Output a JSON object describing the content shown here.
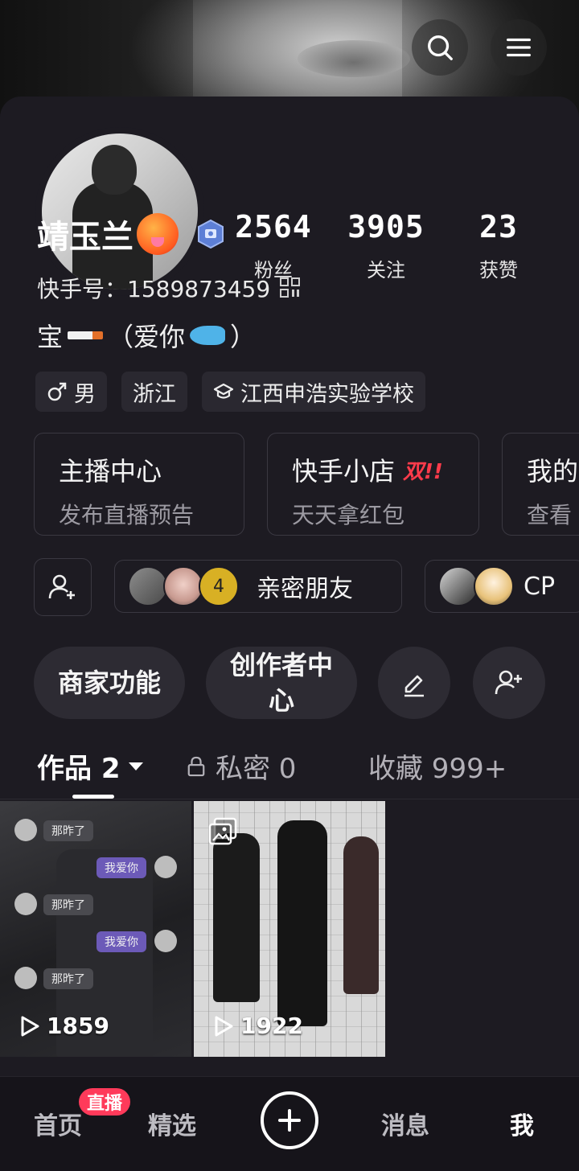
{
  "header": {
    "search_icon": "search-icon",
    "menu_icon": "hamburger-menu-icon"
  },
  "profile": {
    "stats": [
      {
        "value": "2564",
        "label": "粉丝"
      },
      {
        "value": "3905",
        "label": "关注"
      },
      {
        "value": "23",
        "label": "获赞"
      }
    ],
    "nickname": "靖玉兰",
    "account_id": "快手号：1589873459",
    "bio_prefix": "宝",
    "bio_suffix": "（爱你",
    "bio_end": "）",
    "tags": [
      {
        "label": "男",
        "icon": "male-icon"
      },
      {
        "label": "浙江"
      },
      {
        "label": "江西申浩实验学校",
        "icon": "school-icon"
      }
    ]
  },
  "services": [
    {
      "title": "主播中心",
      "sub": "发布直播预告"
    },
    {
      "title": "快手小店",
      "hot": "双!!",
      "sub": "天天拿红包"
    },
    {
      "title": "我的",
      "sub": "查看"
    }
  ],
  "social": {
    "friends_count": "4",
    "friends_label": "亲密朋友",
    "cp_label": "CP"
  },
  "actions": {
    "merchant": "商家功能",
    "creator_line1": "创作者中",
    "creator_line2": "心"
  },
  "tabs": {
    "works": "作品 2",
    "private": "私密 0",
    "favorites": "收藏 999+"
  },
  "grid": [
    {
      "play_count": "1859",
      "chat": {
        "left": "那昨了",
        "right": "我爱你"
      }
    },
    {
      "play_count": "1922"
    }
  ],
  "bottom_nav": {
    "home": "首页",
    "live_badge": "直播",
    "featured": "精选",
    "messages": "消息",
    "me": "我"
  },
  "colors": {
    "background": "#1d1b22",
    "live_badge": "#ff3a5a",
    "hot_text": "#ff3b4b"
  }
}
